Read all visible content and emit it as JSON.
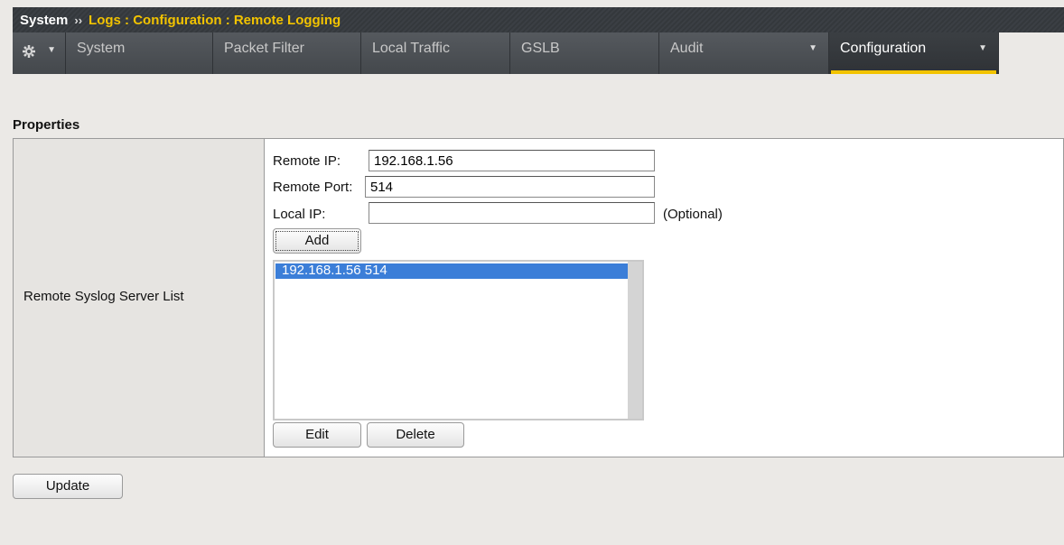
{
  "breadcrumb": {
    "root": "System",
    "separator": "››",
    "path": "Logs : Configuration : Remote Logging"
  },
  "tabs": [
    {
      "label": "",
      "icon": "gear-icon"
    },
    {
      "label": "System"
    },
    {
      "label": "Packet Filter"
    },
    {
      "label": "Local Traffic"
    },
    {
      "label": "GSLB"
    },
    {
      "label": "Audit"
    },
    {
      "label": "Configuration",
      "active": true
    }
  ],
  "section": {
    "title": "Properties"
  },
  "remote_syslog": {
    "label": "Remote Syslog Server List",
    "remote_ip_label": "Remote IP:",
    "remote_ip_value": "192.168.1.56",
    "remote_port_label": "Remote Port:",
    "remote_port_value": "514",
    "local_ip_label": "Local IP:",
    "local_ip_value": "",
    "optional_label": "(Optional)",
    "add_label": "Add",
    "list_items": [
      "192.168.1.56 514"
    ],
    "edit_label": "Edit",
    "delete_label": "Delete"
  },
  "footer": {
    "update_label": "Update"
  },
  "colors": {
    "accent": "#f2c300",
    "selection": "#3b7ed8",
    "header": "#3b3f44"
  }
}
